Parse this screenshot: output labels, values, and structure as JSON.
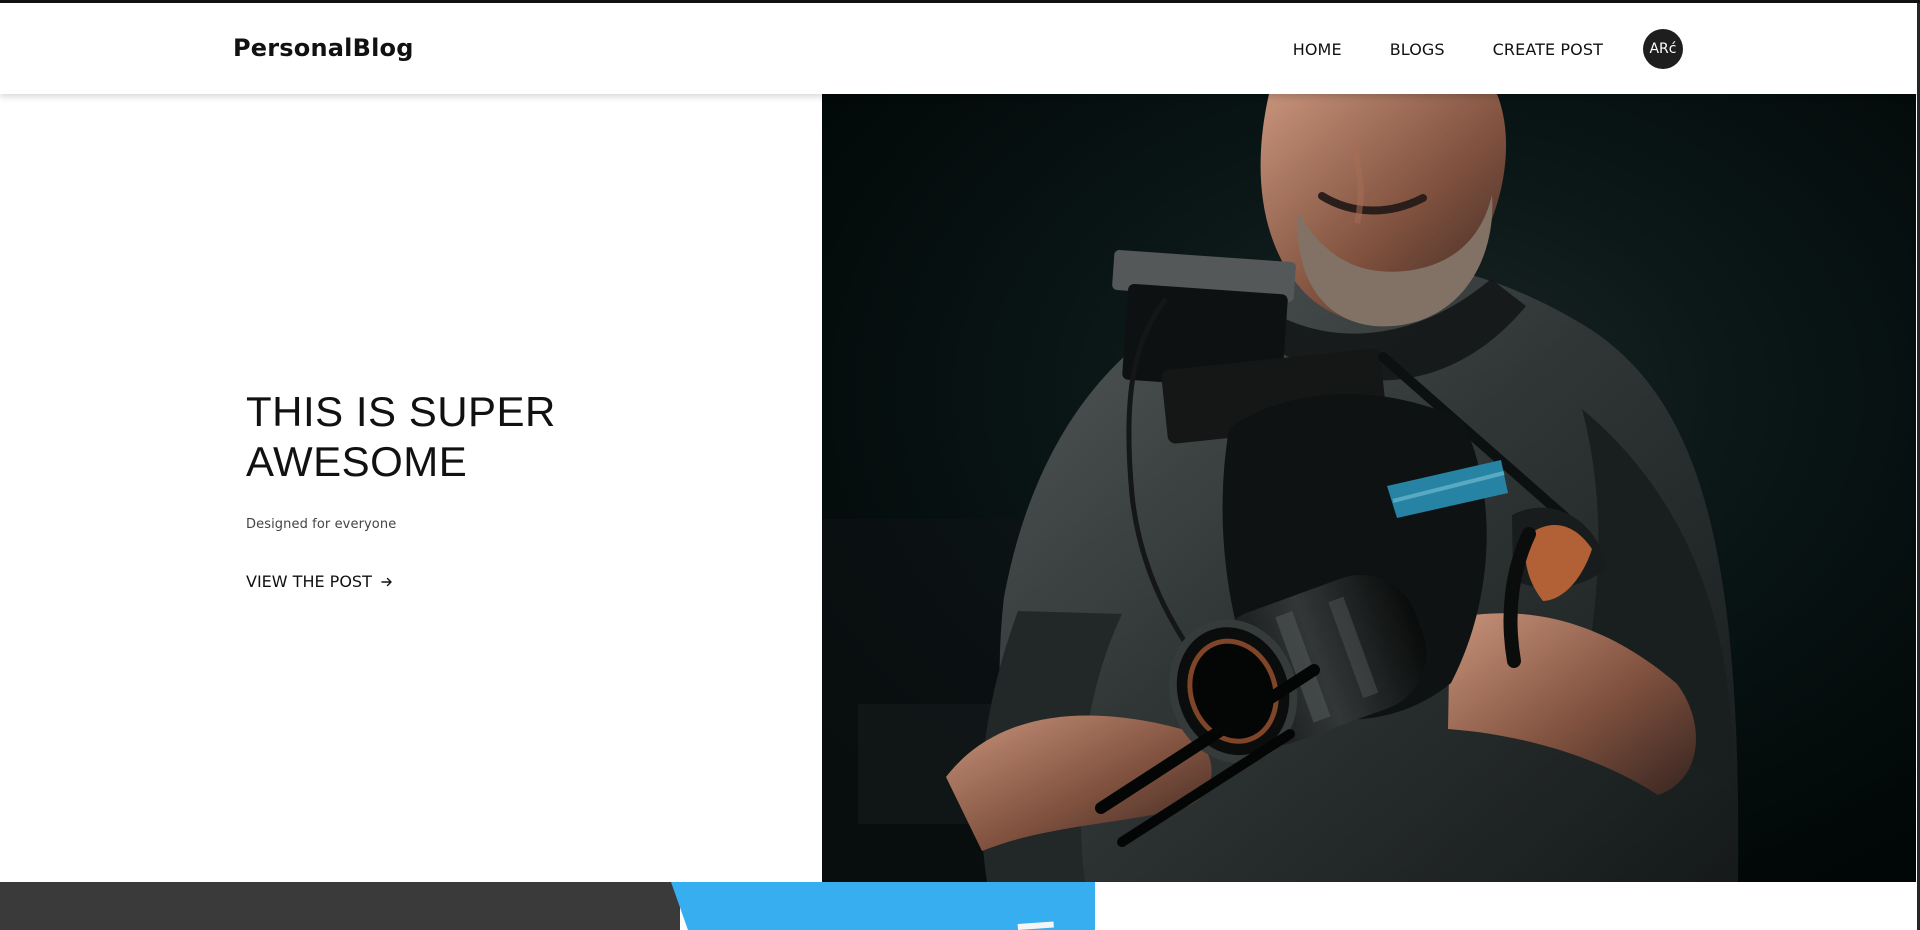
{
  "brand": {
    "name": "PersonalBlog"
  },
  "nav": {
    "home": "HOME",
    "blogs": "BLOGS",
    "create_post": "CREATE POST",
    "avatar": "ARć"
  },
  "hero": {
    "title_line1": "THIS IS SUPER",
    "title_line2": "AWESOME",
    "subtitle": "Designed for everyone",
    "link_label": "VIEW THE POST",
    "arrow_icon": "arrow-right-icon"
  },
  "colors": {
    "header_background": "#ffffff",
    "text": "#111111",
    "avatar_background": "#1e1e1e",
    "photo_background": "#061414",
    "bottom_dark": "#3a3a3a",
    "bottom_blue": "#36aef0"
  }
}
